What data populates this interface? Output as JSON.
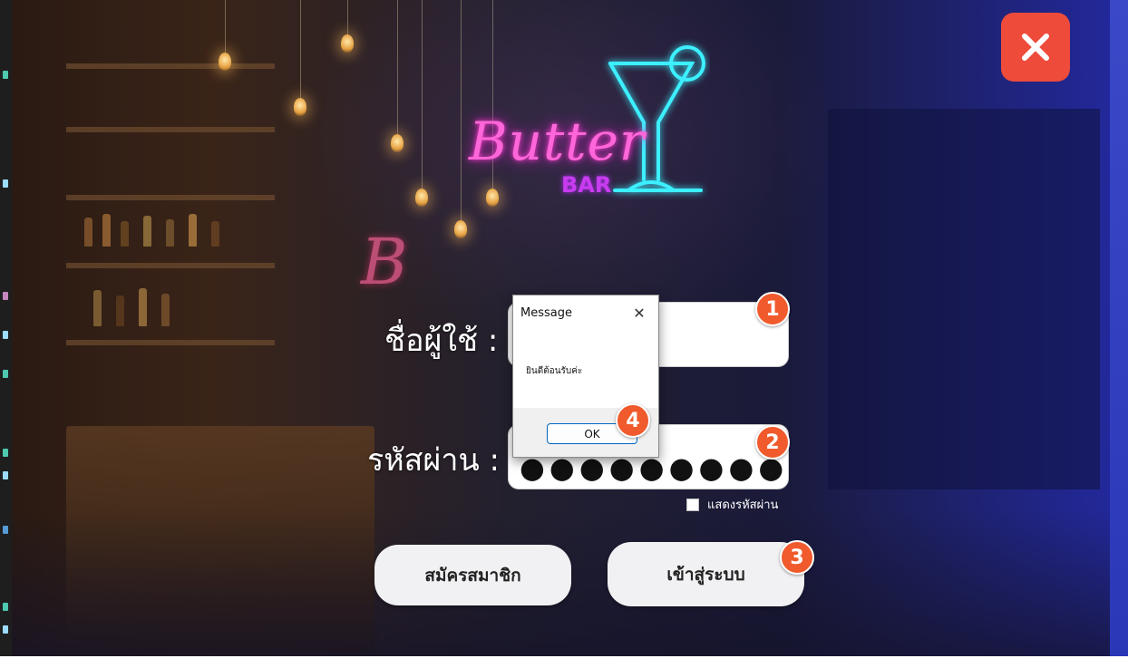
{
  "login_form": {
    "username_label": "ชื่อผู้ใช้ :",
    "password_label": "รหัสผ่าน :",
    "password_masked": "●●●●●●●●●",
    "show_password_label": "แสดงรหัสผ่าน",
    "show_password_checked": false,
    "register_button": "สมัครสมาชิก",
    "login_button": "เข้าสู่ระบบ"
  },
  "logo": {
    "text": "Butter",
    "subtext": "BAR",
    "decor_letter": "B"
  },
  "close_icon": "close-icon",
  "message_box": {
    "title": "Message",
    "text": "ยินดีต้อนรับค่ะ",
    "ok_button": "OK"
  },
  "annotations": [
    "1",
    "2",
    "3",
    "4"
  ],
  "colors": {
    "close_button": "#ee4b3b",
    "badge": "#f05a2c",
    "neon_pink": "#ff66d9",
    "neon_cyan": "#3cf0ff"
  }
}
